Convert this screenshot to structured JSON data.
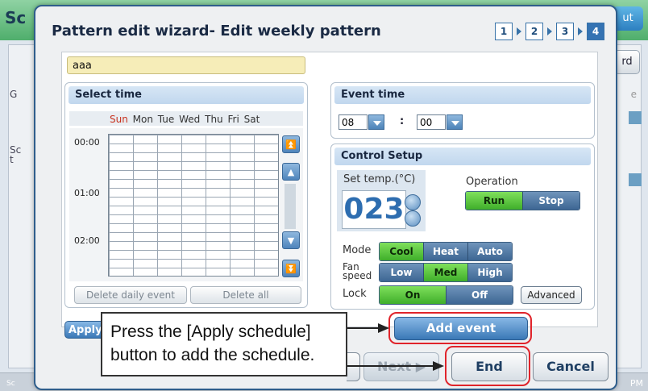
{
  "background": {
    "title_partial": "Sc",
    "top_right_button_partial": "ut",
    "right_button_partial": "rd",
    "label_g_partial": "G",
    "label_sc_partial": "Sc\nt",
    "label_e_partial": "e",
    "footer_left_partial": "Sc",
    "footer_right_partial": "PM"
  },
  "dialog": {
    "title": "Pattern edit wizard- Edit weekly pattern",
    "steps": [
      "1",
      "2",
      "3",
      "4"
    ],
    "active_step": "4"
  },
  "pattern_name": "aaa",
  "select_time": {
    "header": "Select time",
    "days": [
      "Sun",
      "Mon",
      "Tue",
      "Wed",
      "Thu",
      "Fri",
      "Sat"
    ],
    "hours": [
      "00:00",
      "01:00",
      "02:00"
    ],
    "delete_daily_label": "Delete daily event",
    "delete_all_label": "Delete all"
  },
  "event_time": {
    "header": "Event  time",
    "hour": "08",
    "minute": "00",
    "separator": ":"
  },
  "control_setup": {
    "header": "Control Setup",
    "set_temp_label": "Set temp.(°C)",
    "set_temp_value": "023",
    "operation_label": "Operation",
    "operation_options": [
      "Run",
      "Stop"
    ],
    "operation_selected": "Run",
    "mode_label": "Mode",
    "mode_options": [
      "Cool",
      "Heat",
      "Auto"
    ],
    "mode_selected": "Cool",
    "fan_label_line1": "Fan",
    "fan_label_line2": "speed",
    "fan_options": [
      "Low",
      "Med",
      "High"
    ],
    "fan_selected": "Med",
    "lock_label": "Lock",
    "lock_options": [
      "On",
      "Off"
    ],
    "lock_selected": "On",
    "advanced_label": "Advanced"
  },
  "buttons": {
    "add_event": "Add event",
    "apply_partial": "Apply",
    "next": "Next ▶",
    "end": "End",
    "cancel": "Cancel"
  },
  "callout": {
    "line1": "Press the [Apply schedule]",
    "line2": "button to add the schedule."
  },
  "colors": {
    "highlight": "#e0242b",
    "selected_segment": "#4fbf34",
    "button_blue": "#3a78b6"
  }
}
